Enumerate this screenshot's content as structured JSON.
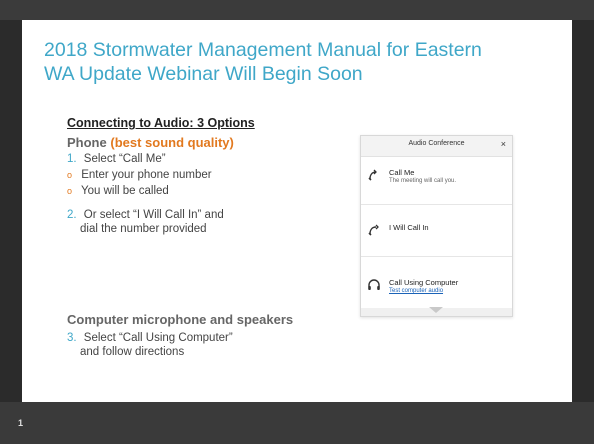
{
  "slide": {
    "title_line1": "2018 Stormwater Management Manual for Eastern",
    "title_line2": "WA Update Webinar Will Begin Soon",
    "section_heading": "Connecting to Audio: 3 Options",
    "phone_heading": "Phone",
    "phone_accent": "(best sound quality)",
    "steps": [
      {
        "num": "1.",
        "text": "Select “Call Me”"
      },
      {
        "num": "2.",
        "text": "Or select “I Will Call In” and",
        "text2": "dial the number provided"
      },
      {
        "num": "3.",
        "text": "Select “Call Using Computer”",
        "text2": "and follow directions"
      }
    ],
    "substeps": [
      {
        "bullet": "o",
        "text": "Enter your phone number"
      },
      {
        "bullet": "o",
        "text": "You will be called"
      }
    ],
    "computer_heading": "Computer microphone and speakers",
    "slide_number": "1"
  },
  "dialog": {
    "title": "Audio Conference",
    "close": "×",
    "options": [
      {
        "label": "Call Me",
        "desc": "The meeting will call you."
      },
      {
        "label": "I Will Call In"
      },
      {
        "label": "Call Using Computer",
        "link": "Test computer audio"
      }
    ]
  },
  "colors": {
    "title": "#3fa7c8",
    "accent_orange": "#e2791f",
    "background_dark": "#2b2b2b",
    "link_blue": "#1b63b8"
  }
}
